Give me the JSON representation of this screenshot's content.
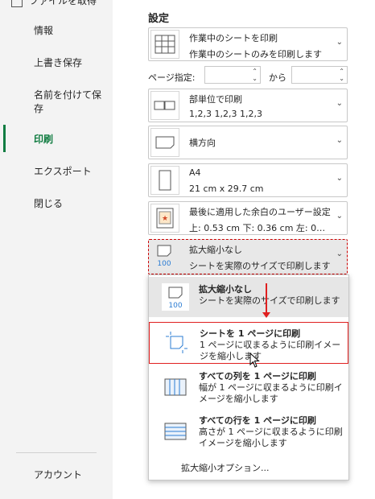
{
  "sidebar": {
    "top_partial": "ファイルを取得",
    "items": [
      {
        "label": "情報"
      },
      {
        "label": "上書き保存"
      },
      {
        "label": "名前を付けて保存"
      },
      {
        "label": "印刷"
      },
      {
        "label": "エクスポート"
      },
      {
        "label": "閉じる"
      }
    ],
    "account": "アカウント"
  },
  "settings": {
    "title": "設定",
    "print_what": {
      "title": "作業中のシートを印刷",
      "desc": "作業中のシートのみを印刷します"
    },
    "pages": {
      "label": "ページ指定:",
      "from": "",
      "to_label": "から",
      "to": ""
    },
    "collate": {
      "title": "部単位で印刷",
      "desc": "1,2,3    1,2,3    1,2,3"
    },
    "orientation": {
      "title": "横方向"
    },
    "paper": {
      "title": "A4",
      "desc": "21 cm x 29.7 cm"
    },
    "margins": {
      "title": "最後に適用した余白のユーザー設定",
      "desc": "上: 0.53 cm 下: 0.36 cm 左: 0…"
    },
    "scaling": {
      "title": "拡大縮小なし",
      "desc": "シートを実際のサイズで印刷します",
      "icon_text": "100"
    }
  },
  "scaling_menu": {
    "items": [
      {
        "title": "拡大縮小なし",
        "desc": "シートを実際のサイズで印刷します",
        "icon_text": "100"
      },
      {
        "title": "シートを 1 ページに印刷",
        "desc": "1 ページに収まるように印刷イメージを縮小します"
      },
      {
        "title": "すべての列を 1 ページに印刷",
        "desc": "幅が 1 ページに収まるように印刷イメージを縮小します"
      },
      {
        "title": "すべての行を 1 ページに印刷",
        "desc": "高さが 1 ページに収まるように印刷イメージを縮小します"
      }
    ],
    "footer": "拡大縮小オプション..."
  },
  "colors": {
    "accent": "#107c41",
    "highlight": "#e02020"
  }
}
